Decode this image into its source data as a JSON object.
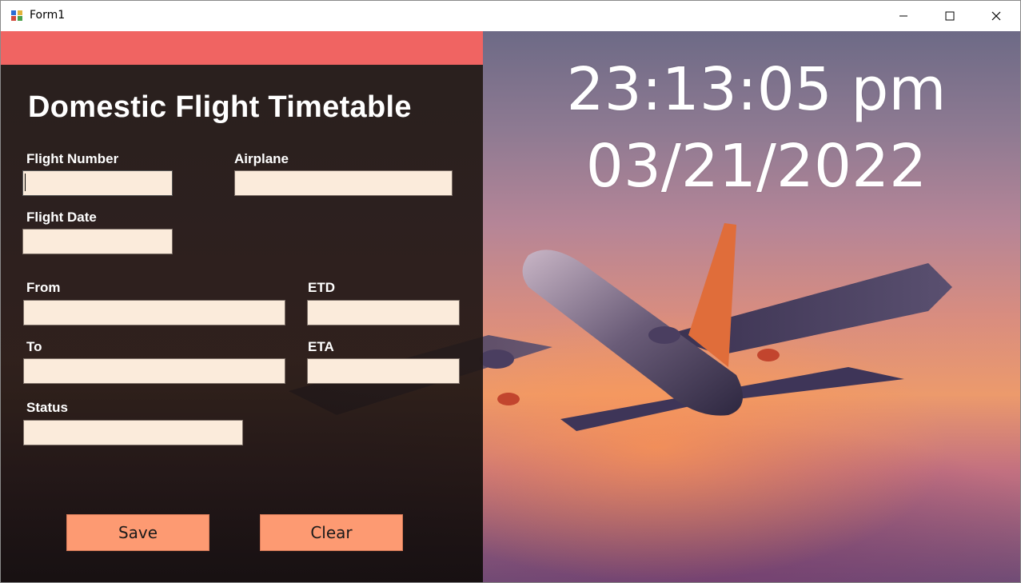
{
  "window": {
    "title": "Form1",
    "icons": {
      "app": "app-icon",
      "minimize": "minimize-icon",
      "maximize": "maximize-icon",
      "close": "close-icon"
    }
  },
  "form": {
    "heading": "Domestic Flight Timetable",
    "labels": {
      "flight_number": "Flight Number",
      "airplane": "Airplane",
      "flight_date": "Flight Date",
      "from": "From",
      "etd": "ETD",
      "to": "To",
      "eta": "ETA",
      "status": "Status"
    },
    "values": {
      "flight_number": "",
      "airplane": "",
      "flight_date": "",
      "from": "",
      "etd": "",
      "to": "",
      "eta": "",
      "status": ""
    },
    "buttons": {
      "save": "Save",
      "clear": "Clear"
    }
  },
  "clock": {
    "time": "23:13:05 pm",
    "date": "03/21/2022"
  },
  "colors": {
    "accent_strip": "#f06462",
    "field_background": "#fbebdb",
    "button_background": "#fd9a72",
    "panel_background": "#261c18"
  }
}
